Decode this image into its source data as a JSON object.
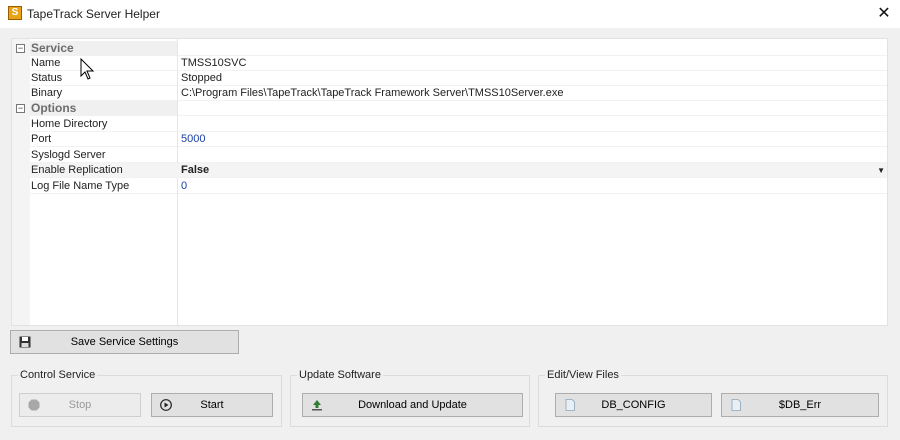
{
  "window": {
    "title": "TapeTrack Server Helper",
    "close_glyph": "✕",
    "app_icon_letter": "S"
  },
  "grid": {
    "categories": [
      {
        "label": "Service",
        "rows": [
          {
            "name": "Name",
            "value": "TMSS10SVC"
          },
          {
            "name": "Status",
            "value": "Stopped"
          },
          {
            "name": "Binary",
            "value": "C:\\Program Files\\TapeTrack\\TapeTrack Framework Server\\TMSS10Server.exe"
          }
        ]
      },
      {
        "label": "Options",
        "rows": [
          {
            "name": "Home Directory",
            "value": ""
          },
          {
            "name": "Port",
            "value": "5000"
          },
          {
            "name": "Syslogd Server",
            "value": ""
          },
          {
            "name": "Enable Replication",
            "value": "False"
          },
          {
            "name": "Log File Name Type",
            "value": "0"
          }
        ]
      }
    ]
  },
  "buttons": {
    "save": "Save Service Settings",
    "stop": "Stop",
    "start": "Start",
    "download": "Download and Update",
    "db_config": "DB_CONFIG",
    "db_err": "$DB_Err"
  },
  "groups": {
    "control": "Control Service",
    "update": "Update Software",
    "files": "Edit/View Files"
  },
  "icons": {
    "app": "tapetrack-app-icon",
    "close": "close-icon",
    "save": "floppy-disk-icon",
    "stop": "stop-octagon-icon",
    "start": "play-circle-icon",
    "download": "download-update-icon",
    "file": "file-icon",
    "cursor": "mouse-cursor-icon"
  }
}
